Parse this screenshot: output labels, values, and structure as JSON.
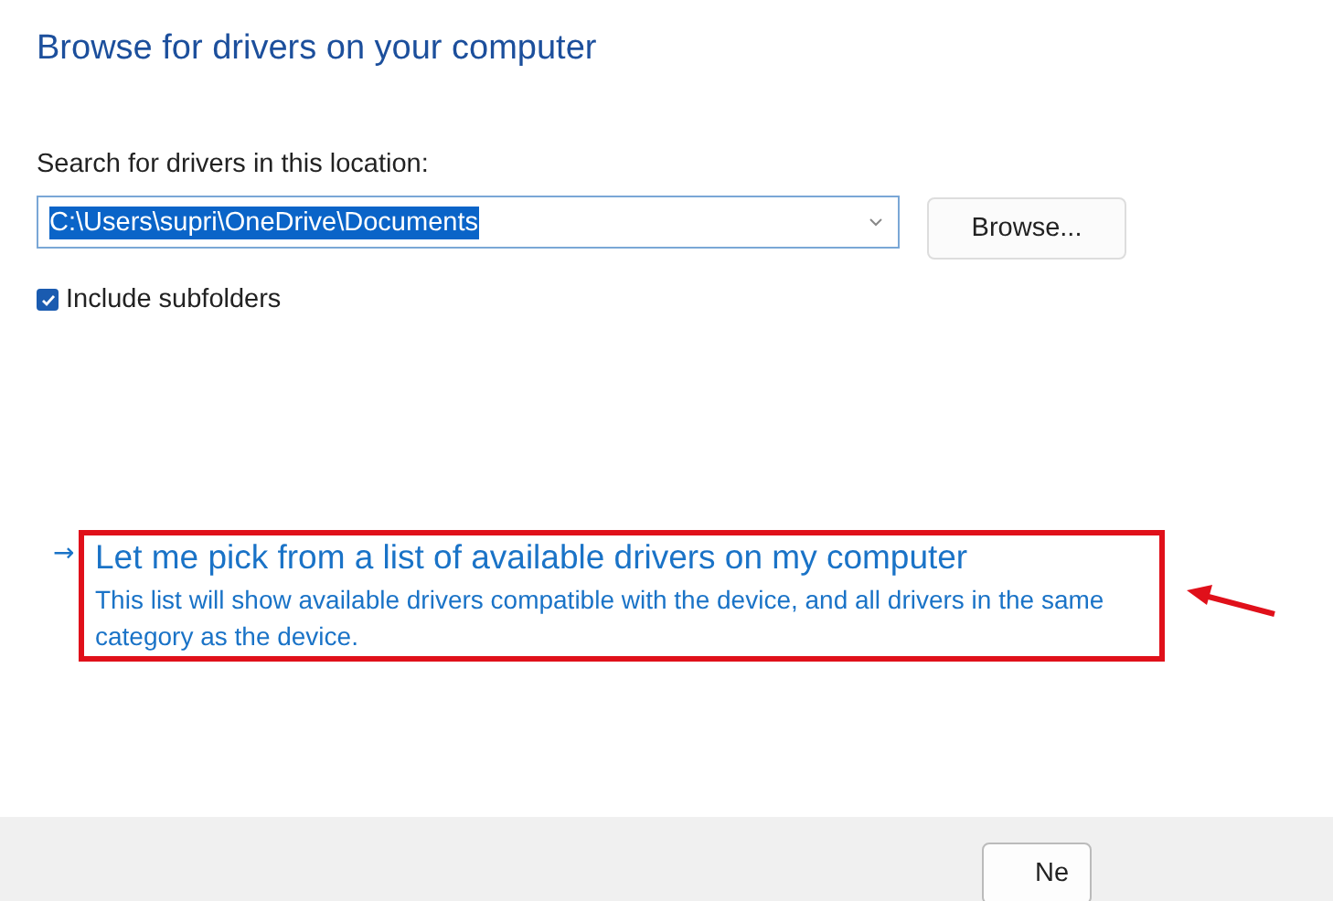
{
  "title": "Browse for drivers on your computer",
  "location": {
    "label": "Search for drivers in this location:",
    "value": "C:\\Users\\supri\\OneDrive\\Documents",
    "highlighted": true
  },
  "browse_button": "Browse...",
  "include_subfolders": {
    "label": "Include subfolders",
    "checked": true
  },
  "pick_link": {
    "arrow": "→",
    "title": "Let me pick from a list of available drivers on my computer",
    "description": "This list will show available drivers compatible with the device, and all drivers in the same category as the device."
  },
  "footer": {
    "buttons": [
      "Ne"
    ]
  }
}
